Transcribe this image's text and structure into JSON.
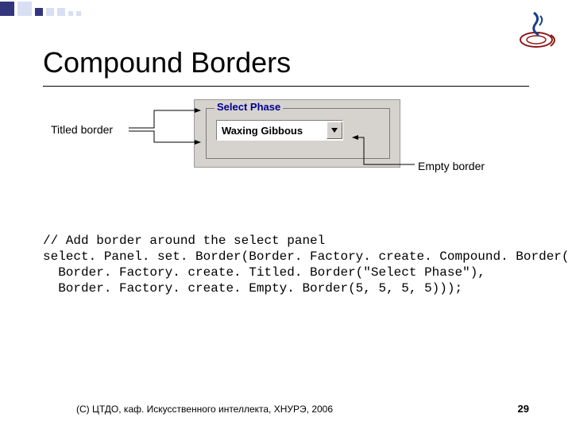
{
  "title": "Compound Borders",
  "figure": {
    "label_titled": "Titled border",
    "label_empty": "Empty border",
    "group_title": "Select Phase",
    "combo_value": "Waxing Gibbous"
  },
  "code": {
    "l1": "// Add border around the select panel",
    "l2": "select. Panel. set. Border(Border. Factory. create. Compound. Border(",
    "l3": "  Border. Factory. create. Titled. Border(\"Select Phase\"),",
    "l4": "  Border. Factory. create. Empty. Border(5, 5, 5, 5)));"
  },
  "footer": {
    "copyright": "(С) ЦТДО, каф. Искусственного интеллекта, ХНУРЭ, 2006",
    "page": "29"
  }
}
